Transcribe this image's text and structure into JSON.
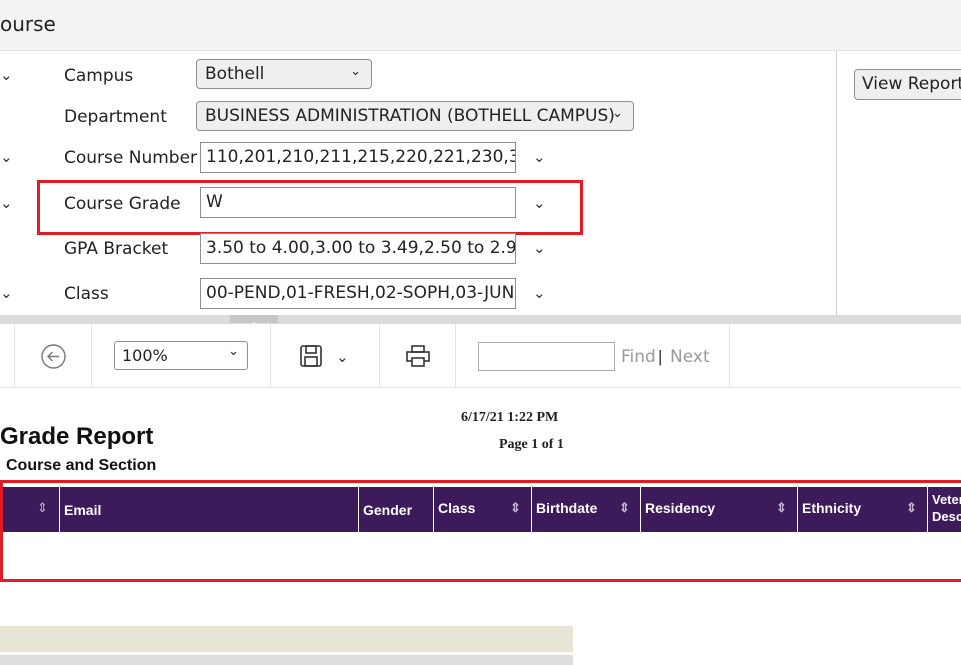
{
  "window": {
    "title": "ourse"
  },
  "params": {
    "campus": {
      "label": "Campus",
      "value": "Bothell"
    },
    "department": {
      "label": "Department",
      "value": "BUSINESS ADMINISTRATION (BOTHELL CAMPUS)"
    },
    "course_number": {
      "label": "Course Number",
      "value": "110,201,210,211,215,220,221,230,300,3"
    },
    "course_grade": {
      "label": "Course Grade",
      "value": "W"
    },
    "gpa_bracket": {
      "label": "GPA Bracket",
      "value": "3.50 to 4.00,3.00 to 3.49,2.50 to 2.99,2."
    },
    "class": {
      "label": "Class",
      "value": "00-PEND,01-FRESH,02-SOPH,03-JUNIO"
    },
    "view_report_label": "View Report"
  },
  "toolbar": {
    "zoom": "100%",
    "find_label": "Find",
    "separator": "|",
    "next_label": "Next",
    "find_placeholder": ""
  },
  "report": {
    "title": "Grade Report",
    "subtitle": "Course and Section",
    "timestamp": "6/17/21 1:22 PM",
    "page": "Page 1 of 1",
    "columns": [
      "Email",
      "Gender",
      "Class",
      "Birthdate",
      "Residency",
      "Ethnicity",
      "Veter",
      "Desc"
    ]
  },
  "colors": {
    "header_purple": "#3d1b5a",
    "highlight_red": "#e01c24"
  }
}
